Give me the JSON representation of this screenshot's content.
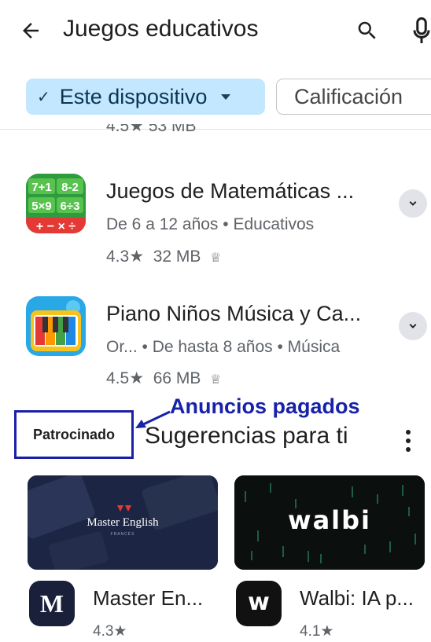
{
  "header": {
    "search_query": "Juegos educativos"
  },
  "chips": [
    {
      "label": "Este dispositivo",
      "selected": true
    },
    {
      "label": "Calificación",
      "selected": false
    }
  ],
  "partial_row": {
    "text": "4.5★  53 MB"
  },
  "apps": [
    {
      "title": "Juegos de Matemáticas ...",
      "meta": "De 6 a 12 años • Educativos",
      "rating": "4.3★",
      "size": "32 MB",
      "icon": "math-game-icon"
    },
    {
      "title": "Piano Niños Música y Ca...",
      "meta": "Or... • De hasta 8 años • Música",
      "rating": "4.5★",
      "size": "66 MB",
      "icon": "piano-kids-icon"
    }
  ],
  "sponsored": {
    "badge": "Patrocinado",
    "annotation": "Anuncios pagados",
    "title": "Sugerencias para ti",
    "cards": [
      {
        "banner_text": "Master English",
        "banner_subtext": "FRANCÉS",
        "logo_text": "M",
        "title": "Master En...",
        "rating": "4.3★"
      },
      {
        "banner_text": "walbi",
        "logo_text": "w",
        "title": "Walbi: IA p...",
        "rating": "4.1★"
      }
    ]
  },
  "colors": {
    "chip_selected_bg": "#c2e7ff",
    "annotation_blue": "#1722a8",
    "text_primary": "#1f1f1f",
    "text_secondary": "#5f6368"
  }
}
